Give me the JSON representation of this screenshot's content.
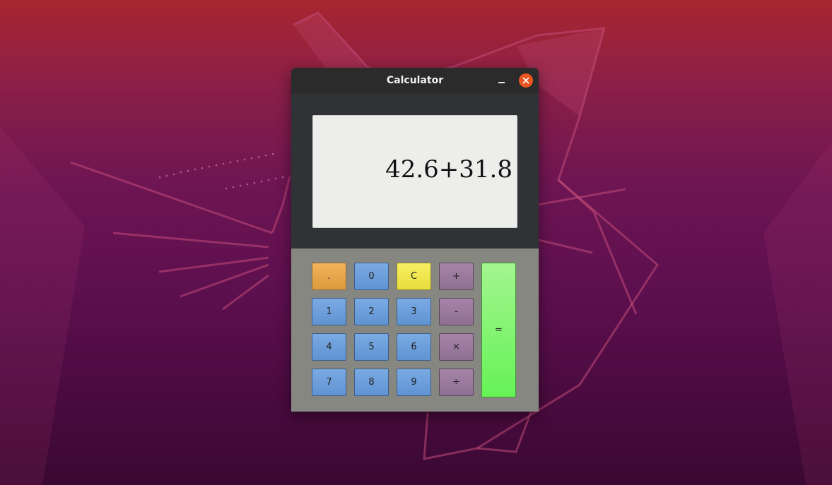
{
  "window": {
    "title": "Calculator"
  },
  "display": {
    "value": "42.6+31.8"
  },
  "keypad": {
    "row1": [
      ".",
      "0",
      "C",
      "+"
    ],
    "row2": [
      "1",
      "2",
      "3",
      "-"
    ],
    "row3": [
      "4",
      "5",
      "6",
      "×"
    ],
    "row4": [
      "7",
      "8",
      "9",
      "÷"
    ],
    "equals": "="
  },
  "colors": {
    "titlebar": "#2b2b2b",
    "display_panel": "#2f3336",
    "display_bg": "#ededeb",
    "keypad_bg": "#878782",
    "digit_key": "#6a9cd9",
    "dot_key": "#e8a84b",
    "clear_key": "#f0e64e",
    "operator_key": "#9a7b9e",
    "equals_key": "#7ef36f",
    "close_button": "#e95420"
  },
  "icons": {
    "minimize": "minimize-icon",
    "close": "close-icon"
  }
}
